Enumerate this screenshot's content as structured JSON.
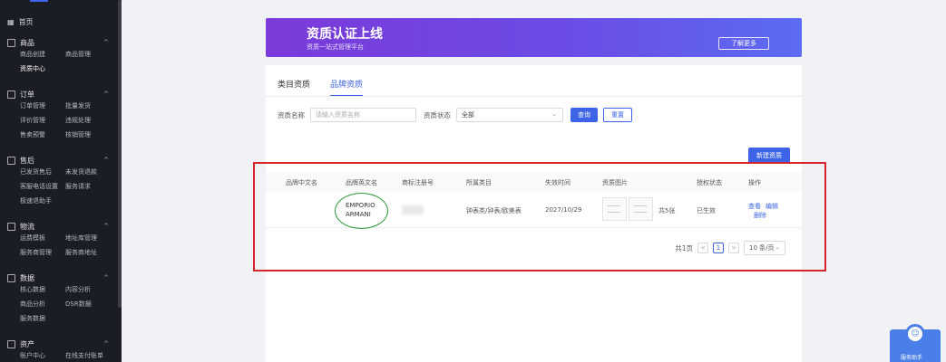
{
  "sidebar": {
    "home": "首页",
    "sections": [
      {
        "title": "商品",
        "items": [
          "商品创建",
          "商品管理",
          "资质中心"
        ],
        "active": 2
      },
      {
        "title": "订单",
        "items": [
          "订单管理",
          "批量发货",
          "评价管理",
          "违规处理",
          "售卖预警",
          "核销管理"
        ]
      },
      {
        "title": "售后",
        "items": [
          "已发货售后",
          "未发货退款",
          "客服电话设置",
          "服务请求",
          "极速退助手"
        ]
      },
      {
        "title": "物流",
        "items": [
          "运费模板",
          "地址库管理",
          "服务商管理",
          "服务商地址"
        ]
      },
      {
        "title": "数据",
        "items": [
          "核心数据",
          "内容分析",
          "商品分析",
          "DSR数据",
          "服务数据"
        ]
      },
      {
        "title": "资产",
        "items": [
          "账户中心",
          "在线支付账单"
        ]
      }
    ]
  },
  "banner": {
    "title": "资质认证上线",
    "subtitle": "资质一站式管理平台",
    "more": "了解更多"
  },
  "tabs": [
    "类目资质",
    "品牌资质"
  ],
  "filters": {
    "name_label": "资质名称",
    "name_placeholder": "请输入资质名称",
    "status_label": "资质状态",
    "status_value": "全部",
    "search": "查询",
    "reset": "重置"
  },
  "new_button": "新建资质",
  "table": {
    "headers": [
      "品牌中文名",
      "品牌英文名",
      "商标注册号",
      "所属类目",
      "失效时间",
      "资质图片",
      "授权状态",
      "操作"
    ],
    "row": {
      "brand_en_line1": "EMPORIO",
      "brand_en_line2": "ARMANI",
      "category": "钟表类/钟表/欧美表",
      "expiry": "2027/10/29",
      "image_count": "共5张",
      "status": "已生效",
      "view": "查看",
      "edit": "编辑",
      "delete": "删除"
    }
  },
  "pager": {
    "total": "共1页",
    "prev": "<",
    "current": "1",
    "next": ">",
    "size": "10 条/页"
  },
  "float_help": {
    "label": "服务助手"
  }
}
